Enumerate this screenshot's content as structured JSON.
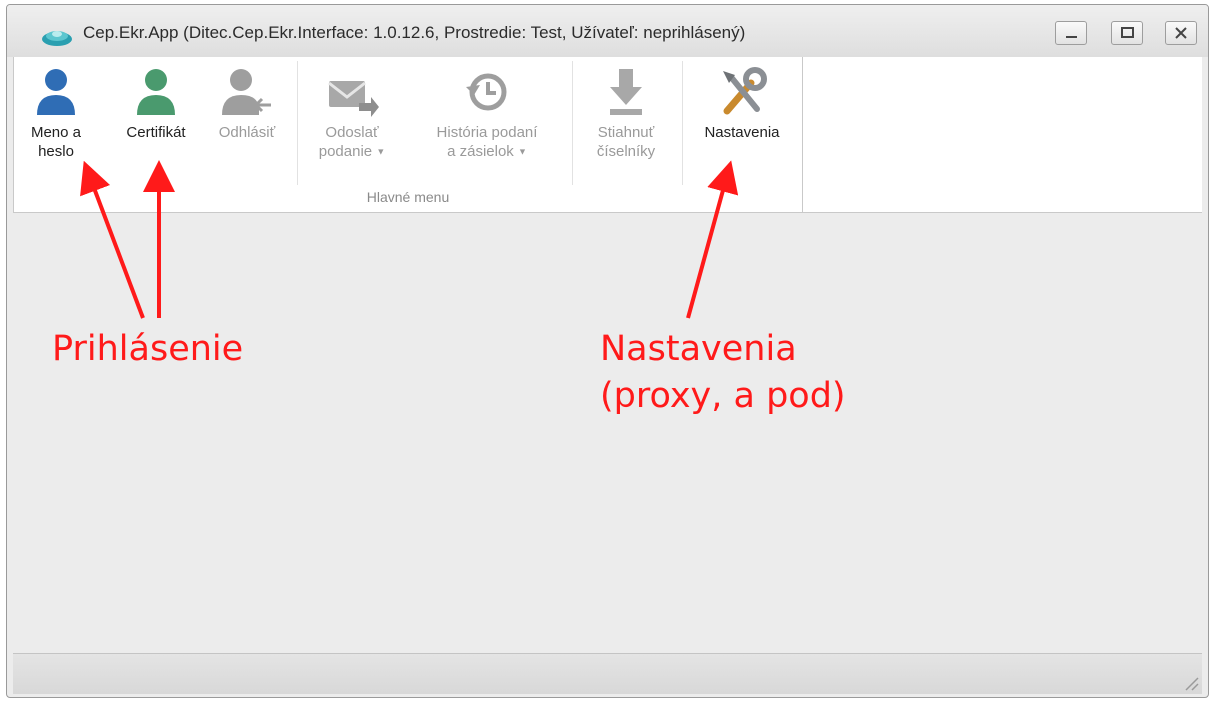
{
  "window": {
    "title": "Cep.Ekr.App (Ditec.Cep.Ekr.Interface: 1.0.12.6, Prostredie: Test, Užívateľ: neprihlásený)"
  },
  "ribbon": {
    "group_label": "Hlavné menu",
    "buttons": [
      {
        "label_line1": "Meno a",
        "label_line2": "heslo",
        "icon": "user-icon",
        "enabled": true
      },
      {
        "label_line1": "Certifikát",
        "label_line2": "",
        "icon": "user-certificate-icon",
        "enabled": true
      },
      {
        "label_line1": "Odhlásiť",
        "label_line2": "",
        "icon": "user-logout-icon",
        "enabled": false
      },
      {
        "label_line1": "Odoslať",
        "label_line2": "podanie",
        "icon": "send-mail-icon",
        "enabled": false
      },
      {
        "label_line1": "História podaní",
        "label_line2": "a zásielok",
        "icon": "history-icon",
        "enabled": false
      },
      {
        "label_line1": "Stiahnuť",
        "label_line2": "číselníky",
        "icon": "download-icon",
        "enabled": false
      },
      {
        "label_line1": "Nastavenia",
        "label_line2": "",
        "icon": "tools-icon",
        "enabled": true
      }
    ]
  },
  "annotations": {
    "login": "Prihlásenie",
    "settings_line1": "Nastavenia",
    "settings_line2": "(proxy, a pod)"
  },
  "colors": {
    "annotation": "#ff1a1a",
    "login_user": "#2f6db5",
    "certificate_user": "#4a9a6e",
    "disabled_icon": "#9e9e9e"
  }
}
